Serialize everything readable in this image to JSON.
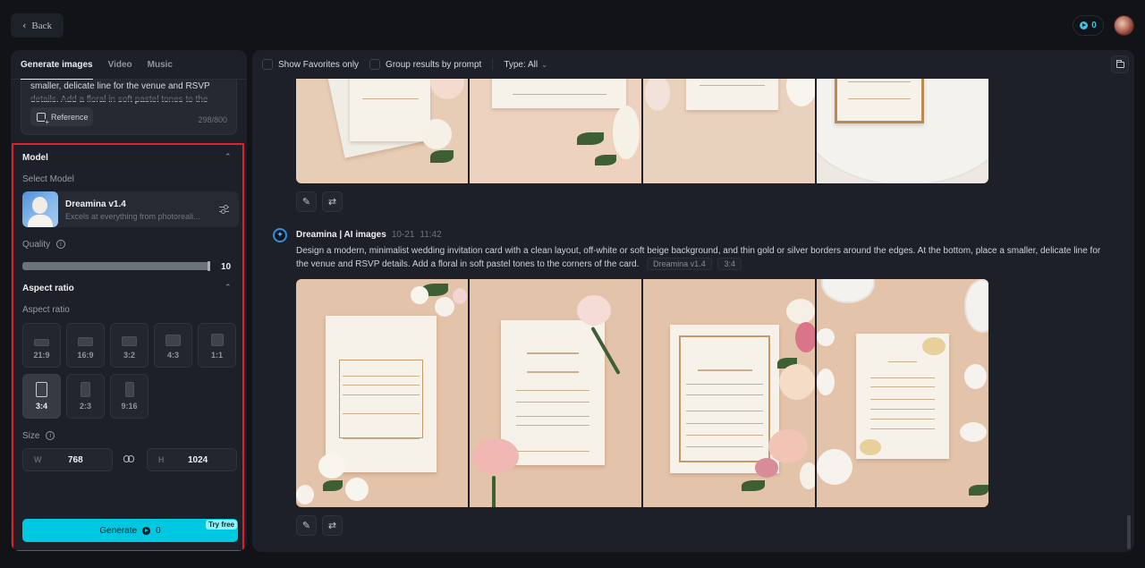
{
  "topbar": {
    "back_label": "Back",
    "credits": "0"
  },
  "left": {
    "tabs": [
      {
        "label": "Generate images",
        "active": true
      },
      {
        "label": "Video",
        "active": false
      },
      {
        "label": "Music",
        "active": false
      }
    ],
    "prompt": {
      "visible_text": "smaller, delicate line for the venue and RSVP details. Add a floral in soft pastel tones to the corners of the",
      "reference_label": "Reference",
      "char_count": "298/800"
    },
    "model": {
      "section_title": "Model",
      "select_label": "Select Model",
      "name": "Dreamina v1.4",
      "description": "Excels at everything from photoreali..."
    },
    "quality": {
      "label": "Quality",
      "value": "10",
      "fraction": 1.0
    },
    "aspect": {
      "section_title": "Aspect ratio",
      "label": "Aspect ratio",
      "options": [
        {
          "label": "21:9",
          "selected": false
        },
        {
          "label": "16:9",
          "selected": false
        },
        {
          "label": "3:2",
          "selected": false
        },
        {
          "label": "4:3",
          "selected": false
        },
        {
          "label": "1:1",
          "selected": false
        },
        {
          "label": "3:4",
          "selected": true
        },
        {
          "label": "2:3",
          "selected": false
        },
        {
          "label": "9:16",
          "selected": false
        }
      ]
    },
    "size": {
      "label": "Size",
      "width_label": "W",
      "width": "768",
      "height_label": "H",
      "height": "1024"
    },
    "generate": {
      "label": "Generate",
      "cost": "0",
      "badge": "Try free"
    }
  },
  "right": {
    "toolbar": {
      "favorites_label": "Show Favorites only",
      "group_label": "Group results by prompt",
      "type_label": "Type: All"
    },
    "messages": [
      {
        "author": "Dreamina | AI images",
        "date": "10-21",
        "time": "11:42",
        "prompt": "Design a modern, minimalist wedding invitation card with a clean layout, off-white or soft beige background, and thin gold or silver borders around the edges. At the bottom, place a smaller, delicate line for the venue and RSVP details. Add a floral in soft pastel tones to the corners of the card.",
        "model_tag": "Dreamina v1.4",
        "ratio_tag": "3:4",
        "images": [
          "wedding invitation with white roses",
          "wedding invitation with pink rose",
          "gold-framed invitation with pink and peach roses",
          "floral-cornered invitation with white flowers and plates"
        ]
      }
    ],
    "prev_images": [
      "invitation with peach and white roses",
      "invitation with floral border",
      "invitation with white rose",
      "gold-framed invitation on plate"
    ],
    "action_icons": [
      "edit-icon",
      "regenerate-icon"
    ]
  }
}
